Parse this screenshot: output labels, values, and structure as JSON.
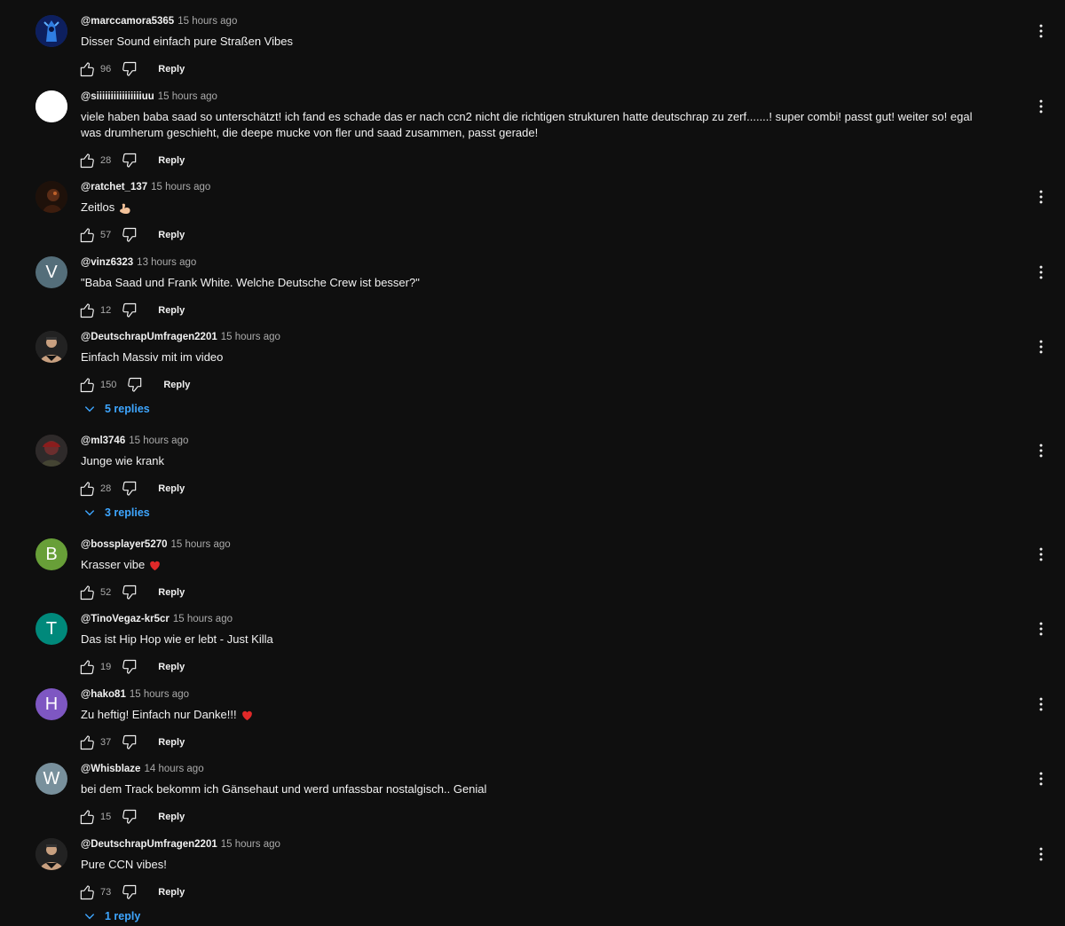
{
  "comments": [
    {
      "author": "@marccamora5365",
      "time": "15 hours ago",
      "text": "Disser Sound einfach pure Straßen Vibes",
      "likes": "96",
      "reply_label": "Reply",
      "avatar": {
        "type": "image",
        "bg": "#1c3a8a"
      }
    },
    {
      "author": "@siiiiiiiiiiiiiiiiuu",
      "time": "15 hours ago",
      "text": "viele haben baba saad so unterschätzt! ich fand es schade das er nach ccn2 nicht die richtigen strukturen hatte deutschrap zu zerf.......! super combi! passt gut! weiter so! egal was drumherum geschieht, die deepe mucke von fler und saad zusammen, passt gerade!",
      "likes": "28",
      "reply_label": "Reply",
      "avatar": {
        "type": "image",
        "bg": "#ffffff"
      }
    },
    {
      "author": "@ratchet_137",
      "time": "15 hours ago",
      "text": "Zeitlos",
      "emoji": "flexed-biceps",
      "likes": "57",
      "reply_label": "Reply",
      "avatar": {
        "type": "image",
        "bg": "#2a1810"
      }
    },
    {
      "author": "@vinz6323",
      "time": "13 hours ago",
      "text": "\"Baba Saad und Frank White. Welche Deutsche Crew ist besser?\"",
      "likes": "12",
      "reply_label": "Reply",
      "avatar": {
        "type": "letter",
        "letter": "V",
        "bg": "#546e7a"
      }
    },
    {
      "author": "@DeutschrapUmfragen2201",
      "time": "15 hours ago",
      "text": "Einfach Massiv mit im video",
      "likes": "150",
      "reply_label": "Reply",
      "replies_label": "5 replies",
      "avatar": {
        "type": "image",
        "bg": "#2b2b2b"
      }
    },
    {
      "author": "@ml3746",
      "time": "15 hours ago",
      "text": "Junge wie krank",
      "likes": "28",
      "reply_label": "Reply",
      "replies_label": "3 replies",
      "avatar": {
        "type": "image",
        "bg": "#3a2626"
      }
    },
    {
      "author": "@bossplayer5270",
      "time": "15 hours ago",
      "text": "Krasser vibe",
      "emoji": "red-heart",
      "likes": "52",
      "reply_label": "Reply",
      "avatar": {
        "type": "letter",
        "letter": "B",
        "bg": "#689f38"
      }
    },
    {
      "author": "@TinoVegaz-kr5cr",
      "time": "15 hours ago",
      "text": "Das ist Hip Hop wie er lebt - Just Killa",
      "likes": "19",
      "reply_label": "Reply",
      "avatar": {
        "type": "letter",
        "letter": "T",
        "bg": "#00897b"
      }
    },
    {
      "author": "@hako81",
      "time": "15 hours ago",
      "text": "Zu heftig! Einfach nur Danke!!!",
      "emoji": "red-heart",
      "likes": "37",
      "reply_label": "Reply",
      "avatar": {
        "type": "letter",
        "letter": "H",
        "bg": "#7e57c2"
      }
    },
    {
      "author": "@Whisblaze",
      "time": "14 hours ago",
      "text": "bei dem Track bekomm ich Gänsehaut und werd unfassbar nostalgisch.. Genial",
      "likes": "15",
      "reply_label": "Reply",
      "avatar": {
        "type": "letter",
        "letter": "W",
        "bg": "#78909c"
      }
    },
    {
      "author": "@DeutschrapUmfragen2201",
      "time": "15 hours ago",
      "text": "Pure CCN vibes!",
      "likes": "73",
      "reply_label": "Reply",
      "replies_label": "1 reply",
      "avatar": {
        "type": "image",
        "bg": "#2b2b2b"
      }
    }
  ],
  "colors": {
    "background": "#0f0f0f",
    "text": "#f1f1f1",
    "secondary": "#aaaaaa",
    "link": "#3ea6ff"
  }
}
